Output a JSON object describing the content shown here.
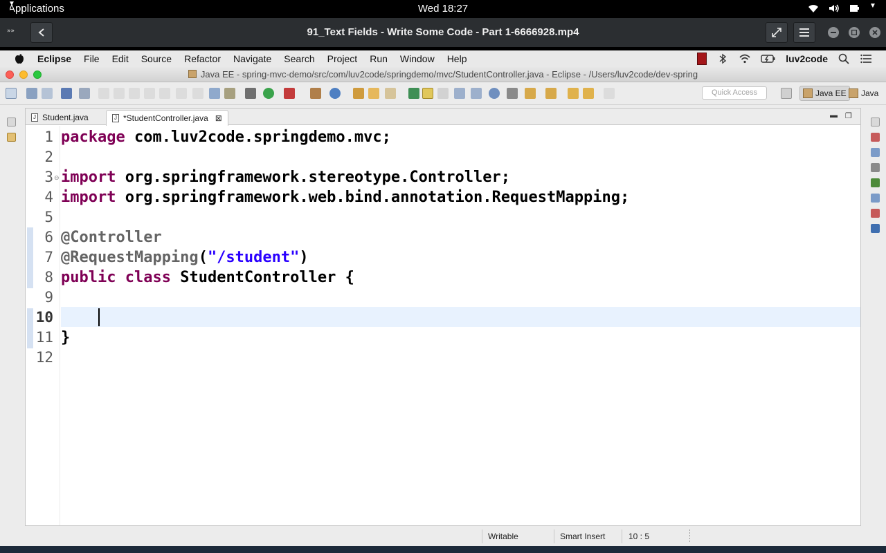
{
  "gnome": {
    "activities_label": "Applications",
    "clock": "Wed 18:27"
  },
  "player": {
    "title": "91_Text Fields - Write Some Code - Part 1-6666928.mp4"
  },
  "mac_menu": {
    "app_name": "Eclipse",
    "items": [
      "File",
      "Edit",
      "Source",
      "Refactor",
      "Navigate",
      "Search",
      "Project",
      "Run",
      "Window",
      "Help"
    ],
    "user": "luv2code"
  },
  "window": {
    "title": "Java EE - spring-mvc-demo/src/com/luv2code/springdemo/mvc/StudentController.java - Eclipse - /Users/luv2code/dev-spring"
  },
  "toolbar": {
    "quick_access_placeholder": "Quick Access",
    "perspectives": [
      "Java EE",
      "Java"
    ]
  },
  "tabs": [
    {
      "label": "Student.java",
      "active": false
    },
    {
      "label": "*StudentController.java",
      "active": true
    }
  ],
  "editor": {
    "line_numbers": [
      "1",
      "2",
      "3",
      "4",
      "5",
      "6",
      "7",
      "8",
      "9",
      "10",
      "11",
      "12"
    ],
    "current_line": "10"
  },
  "status": {
    "writable": "Writable",
    "insert_mode": "Smart Insert",
    "cursor_position": "10 : 5"
  },
  "colors": {
    "keyword": "#7f0055",
    "annotation": "#646464",
    "string": "#2a00ff",
    "current_line_bg": "#e8f2fe"
  }
}
